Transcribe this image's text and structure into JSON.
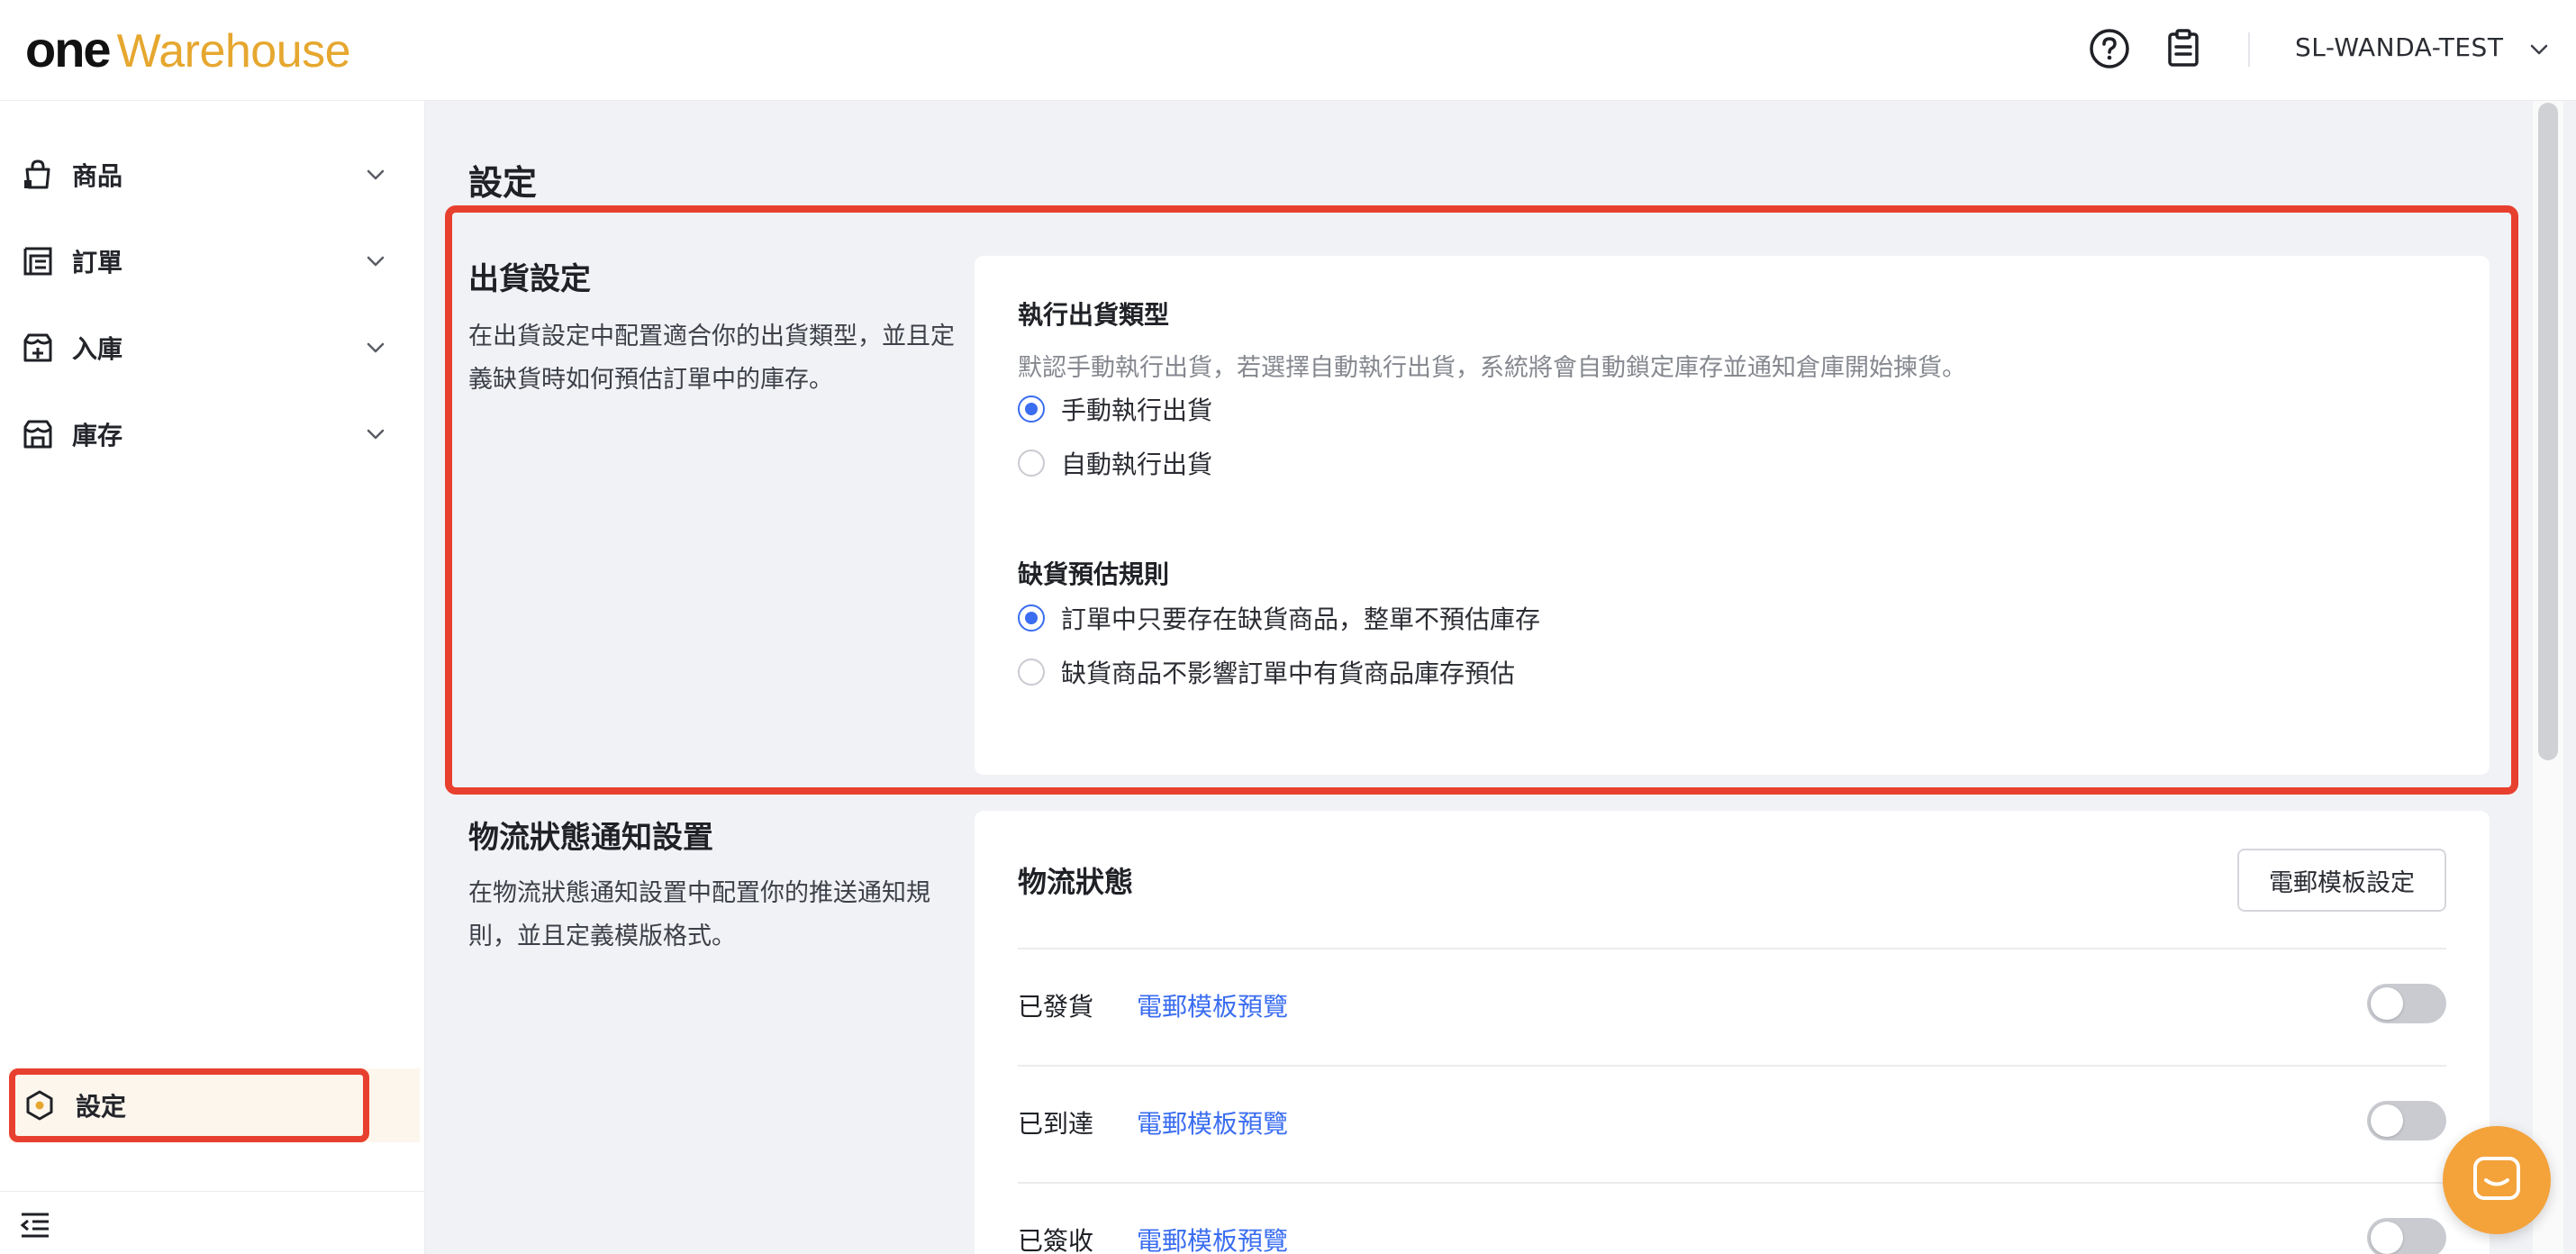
{
  "header": {
    "logo_one": "one",
    "logo_warehouse": "Warehouse",
    "help_icon": "help-circle-icon",
    "clipboard_icon": "clipboard-icon",
    "user_name": "SL-WANDA-TEST"
  },
  "sidebar": {
    "items": [
      {
        "label": "商品",
        "icon": "bag-icon"
      },
      {
        "label": "訂單",
        "icon": "order-list-icon"
      },
      {
        "label": "入庫",
        "icon": "inbound-icon"
      },
      {
        "label": "庫存",
        "icon": "store-icon"
      }
    ],
    "settings_label": "設定",
    "settings_icon": "hexagon-settings-icon",
    "collapse_icon": "collapse-menu-icon"
  },
  "main": {
    "page_title": "設定",
    "shipping": {
      "title": "出貨設定",
      "desc": "在出貨設定中配置適合你的出貨類型，並且定義缺貨時如何預估訂單中的庫存。",
      "exec_type": {
        "title": "執行出貨類型",
        "hint": "默認手動執行出貨，若選擇自動執行出貨，系統將會自動鎖定庫存並通知倉庫開始揀貨。",
        "options": [
          "手動執行出貨",
          "自動執行出貨"
        ],
        "selected": "手動執行出貨"
      },
      "stockout": {
        "title": "缺貨預估規則",
        "options": [
          "訂單中只要存在缺貨商品，整單不預估庫存",
          "缺貨商品不影響訂單中有貨商品庫存預估"
        ],
        "selected": "訂單中只要存在缺貨商品，整單不預估庫存"
      }
    },
    "logistics": {
      "title": "物流狀態通知設置",
      "desc": "在物流狀態通知設置中配置你的推送通知規則，並且定義模版格式。",
      "card_title": "物流狀態",
      "template_button": "電郵模板設定",
      "rows": [
        {
          "label": "已發貨",
          "link": "電郵模板預覽",
          "enabled": false
        },
        {
          "label": "已到達",
          "link": "電郵模板預覽",
          "enabled": false
        },
        {
          "label": "已簽收",
          "link": "電郵模板預覽",
          "enabled": false
        }
      ]
    }
  },
  "colors": {
    "accent": "#3a6df0",
    "highlight": "#e8402f",
    "brand": "#e6a72f",
    "chat": "#f4a23a"
  },
  "chat_icon": "chat-icon"
}
